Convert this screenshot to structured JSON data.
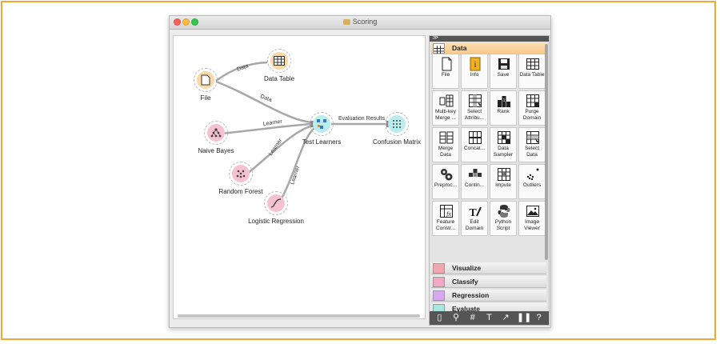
{
  "window": {
    "title": "Scoring"
  },
  "canvas": {
    "widgets": {
      "file": "File",
      "data_table": "Data Table",
      "naive_bayes": "Naive Bayes",
      "random_forest": "Random Forest",
      "logistic_regression": "Logistic Regression",
      "test_learners": "Test Learners",
      "confusion_matrix": "Confusion Matrix"
    },
    "links": {
      "file_to_table": "Data",
      "file_to_test": "Data",
      "nb_to_test": "Learner",
      "rf_to_test": "Learner",
      "lr_to_test": "Learner",
      "test_to_cm": "Evaluation Results"
    }
  },
  "toolbox": {
    "header_glyph": "≫",
    "categories": {
      "data": "Data",
      "visualize": "Visualize",
      "classify": "Classify",
      "regression": "Regression",
      "evaluate": "Evaluate"
    },
    "category_colors": {
      "data": "#f7c98d",
      "visualize": "#f0a8b0",
      "classify": "#f2a8c4",
      "regression": "#d6a8ee",
      "evaluate": "#a8e6e0"
    },
    "tiles": [
      {
        "label": "File",
        "icon": "file-icon"
      },
      {
        "label": "Info",
        "icon": "info-icon"
      },
      {
        "label": "Save",
        "icon": "save-icon"
      },
      {
        "label": "Data Table",
        "icon": "table-icon"
      },
      {
        "label": "Multi-key Merge ...",
        "icon": "merge-icon"
      },
      {
        "label": "Select Attribu...",
        "icon": "select-columns-icon"
      },
      {
        "label": "Rank",
        "icon": "rank-icon"
      },
      {
        "label": "Purge Domain",
        "icon": "purge-icon"
      },
      {
        "label": "Merge Data",
        "icon": "merge-data-icon"
      },
      {
        "label": "Concat...",
        "icon": "concatenate-icon"
      },
      {
        "label": "Data Sampler",
        "icon": "sampler-icon"
      },
      {
        "label": "Select Data",
        "icon": "select-data-icon"
      },
      {
        "label": "Preproc...",
        "icon": "gears-icon"
      },
      {
        "label": "Contin...",
        "icon": "continuize-icon"
      },
      {
        "label": "Impute",
        "icon": "impute-icon"
      },
      {
        "label": "Outliers",
        "icon": "outliers-icon"
      },
      {
        "label": "Feature Constr...",
        "icon": "feature-constructor-icon"
      },
      {
        "label": "Edit Domain",
        "icon": "edit-domain-icon"
      },
      {
        "label": "Python Script",
        "icon": "python-icon"
      },
      {
        "label": "Image Viewer",
        "icon": "image-viewer-icon"
      }
    ],
    "tools": [
      {
        "name": "document-tool-icon",
        "glyph": "▯"
      },
      {
        "name": "zoom-tool-icon",
        "glyph": "⚲"
      },
      {
        "name": "grid-tool-icon",
        "glyph": "#"
      },
      {
        "name": "text-tool-icon",
        "glyph": "T"
      },
      {
        "name": "arrow-tool-icon",
        "glyph": "↗"
      },
      {
        "name": "pause-tool-icon",
        "glyph": "❚❚"
      },
      {
        "name": "help-tool-icon",
        "glyph": "?"
      }
    ]
  }
}
